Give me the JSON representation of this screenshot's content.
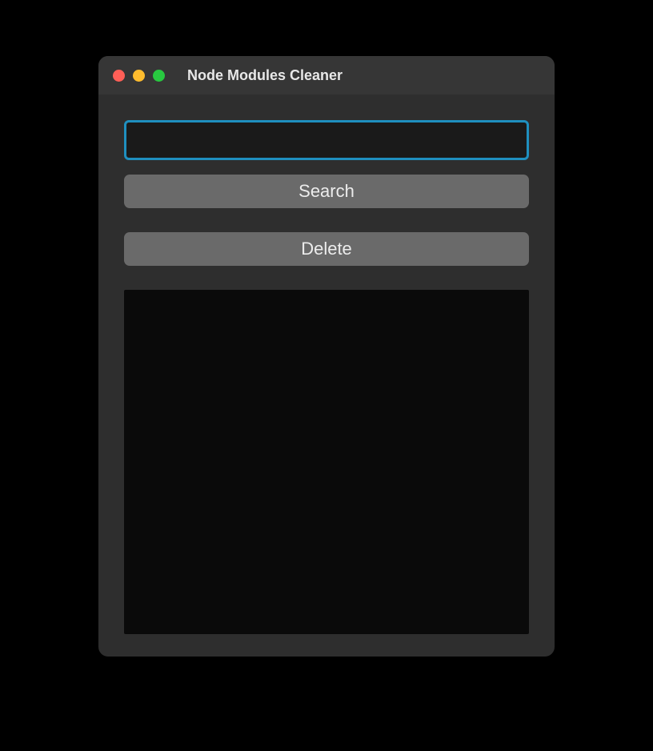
{
  "window": {
    "title": "Node Modules Cleaner"
  },
  "input": {
    "value": "",
    "placeholder": ""
  },
  "buttons": {
    "search": "Search",
    "delete": "Delete"
  },
  "output": {
    "content": ""
  }
}
